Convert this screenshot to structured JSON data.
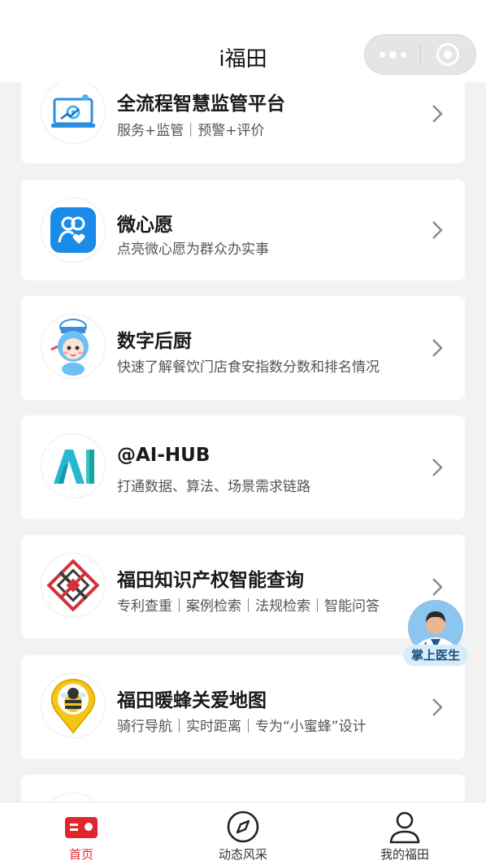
{
  "header": {
    "title": "i福田"
  },
  "capsule": {
    "more_icon": "more-dots-icon",
    "close_icon": "target-close-icon"
  },
  "services": [
    {
      "title": "全流程智慧监管平台",
      "subtitle": "服务+监管｜预警+评价",
      "icon": "monitor-gear-icon"
    },
    {
      "title": "微心愿",
      "subtitle": "点亮微心愿为群众办实事",
      "icon": "people-heart-icon"
    },
    {
      "title": "数字后厨",
      "subtitle": "快速了解餐饮门店食安指数分数和排名情况",
      "icon": "chef-mascot-icon"
    },
    {
      "title": "@AI-HUB",
      "subtitle": "打通数据、算法、场景需求链路",
      "icon": "ai-logo-icon"
    },
    {
      "title": "福田知识产权智能查询",
      "subtitle": "专利查重｜案例检索｜法规检索｜智能问答",
      "icon": "ip-knot-icon"
    },
    {
      "title": "福田暖蜂关爱地图",
      "subtitle": "骑行导航｜实时距离｜专为“小蜜蜂”设计",
      "icon": "bee-pin-icon"
    }
  ],
  "floating": {
    "label": "掌上医生",
    "icon": "doctor-avatar-icon"
  },
  "tabbar": [
    {
      "label": "首页",
      "icon": "home-card-icon",
      "active": true,
      "color": "#e0262c"
    },
    {
      "label": "动态风采",
      "icon": "compass-icon",
      "active": false
    },
    {
      "label": "我的福田",
      "icon": "user-icon",
      "active": false
    }
  ]
}
